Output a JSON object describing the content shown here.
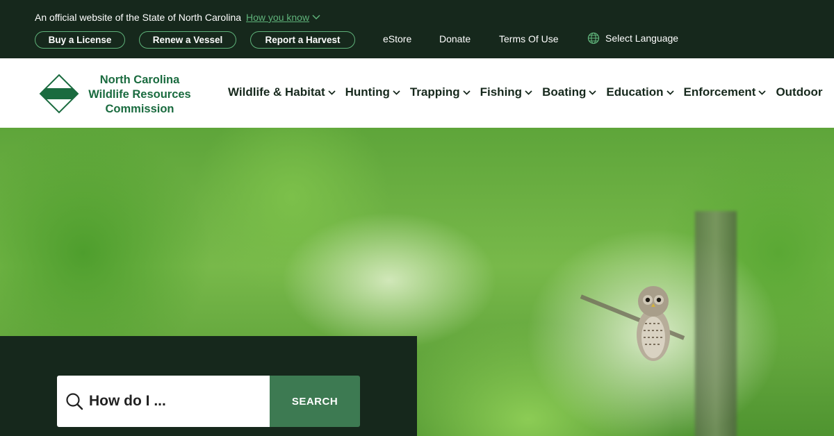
{
  "topbar": {
    "official_text": "An official website of the State of North Carolina",
    "how_you_know": "How you know",
    "pills": [
      "Buy a License",
      "Renew a Vessel",
      "Report a Harvest"
    ],
    "links": [
      "eStore",
      "Donate",
      "Terms Of Use"
    ],
    "language": "Select Language"
  },
  "header": {
    "logo_lines": [
      "North Carolina",
      "Wildlife Resources",
      "Commission"
    ],
    "nav": [
      "Wildlife & Habitat",
      "Hunting",
      "Trapping",
      "Fishing",
      "Boating",
      "Education",
      "Enforcement",
      "Outdoor"
    ]
  },
  "search": {
    "placeholder": "How do I ...",
    "button": "SEARCH"
  },
  "colors": {
    "dark_green": "#16281c",
    "accent_green": "#5fb37a",
    "brand_green": "#1a6b3f",
    "search_button": "#3d7a52"
  }
}
